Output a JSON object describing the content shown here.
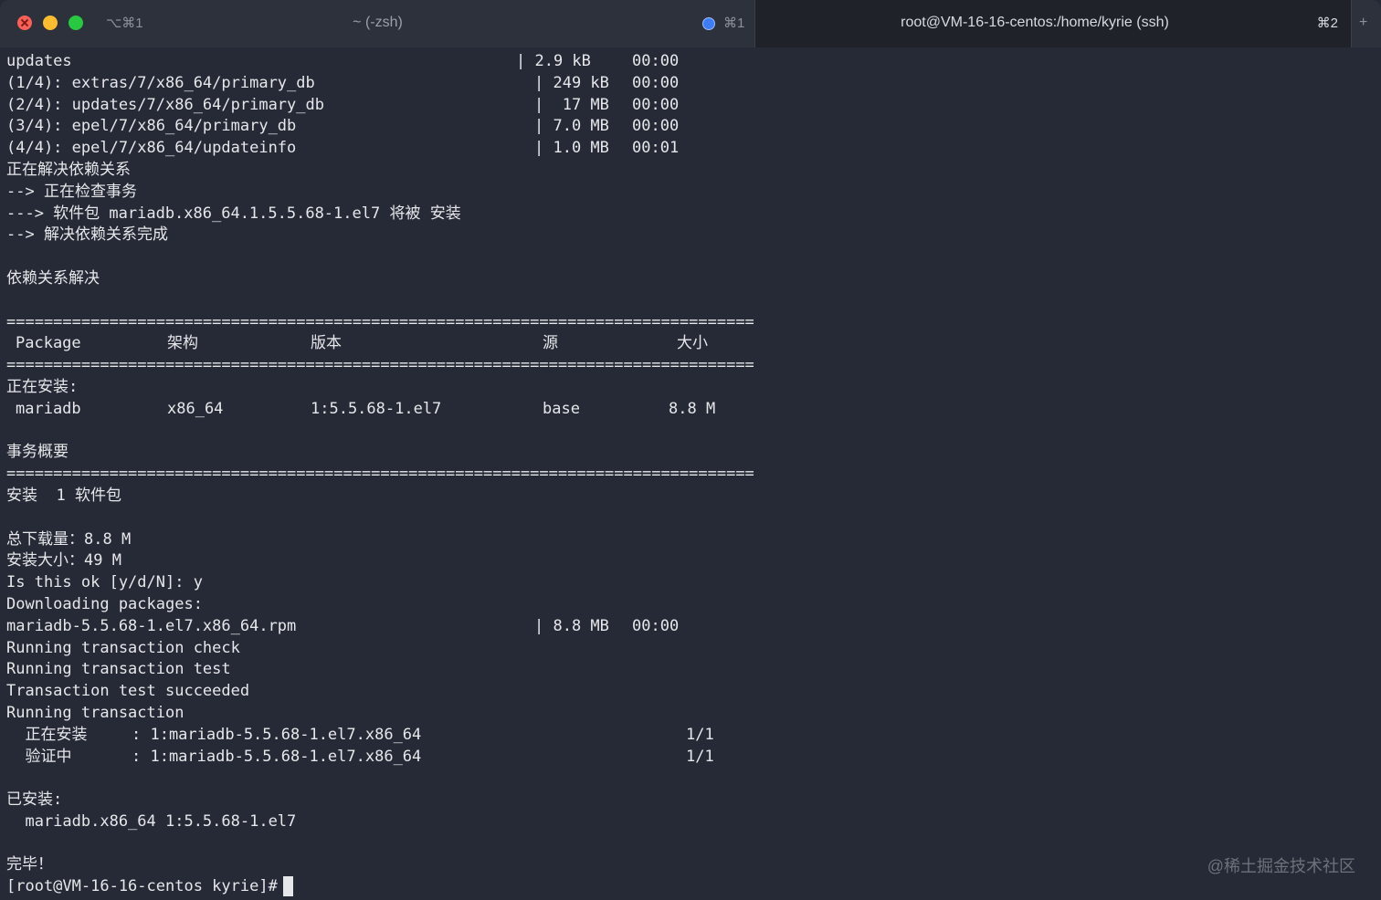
{
  "tab_bar": {
    "left_shortcut": "⌥⌘1",
    "tab1": {
      "title": "~ (-zsh)",
      "shortcut": "⌘1"
    },
    "tab2": {
      "title": "root@VM-16-16-centos:/home/kyrie (ssh)",
      "shortcut": "⌘2"
    },
    "new_tab": "+"
  },
  "terminal": {
    "download_rows": [
      {
        "name": "updates",
        "size": "| 2.9 kB",
        "time": "00:00"
      },
      {
        "name": "(1/4): extras/7/x86_64/primary_db",
        "size": "| 249 kB",
        "time": "00:00"
      },
      {
        "name": "(2/4): updates/7/x86_64/primary_db",
        "size": "|  17 MB",
        "time": "00:00"
      },
      {
        "name": "(3/4): epel/7/x86_64/primary_db",
        "size": "| 7.0 MB",
        "time": "00:00"
      },
      {
        "name": "(4/4): epel/7/x86_64/updateinfo",
        "size": "| 1.0 MB",
        "time": "00:01"
      }
    ],
    "resolving": "正在解决依赖关系",
    "checking": "--> 正在检查事务",
    "package_install": "---> 软件包 mariadb.x86_64.1.5.5.68-1.el7 将被 安装",
    "resolve_done": "--> 解决依赖关系完成",
    "deps_resolved": "依赖关系解决",
    "separator": "================================================================================",
    "table_header": {
      "package": "Package",
      "arch": "架构",
      "version": "版本",
      "repo": "源",
      "size": "大小"
    },
    "installing_label": "正在安装:",
    "table_row": {
      "package": "mariadb",
      "arch": "x86_64",
      "version": "1:5.5.68-1.el7",
      "repo": "base",
      "size": "8.8 M"
    },
    "summary_label": "事务概要",
    "install_count": "安装  1 软件包",
    "total_download": "总下载量：8.8 M",
    "install_size": "安装大小：49 M",
    "prompt_ok": "Is this ok [y/d/N]: y",
    "downloading": "Downloading packages:",
    "rpm_row": {
      "name": "mariadb-5.5.68-1.el7.x86_64.rpm",
      "size": "| 8.8 MB",
      "time": "00:00"
    },
    "check": "Running transaction check",
    "test": "Running transaction test",
    "test_ok": "Transaction test succeeded",
    "running": "Running transaction",
    "step_install": {
      "label": "  正在安装    ",
      "pkg": ": 1:mariadb-5.5.68-1.el7.x86_64",
      "count": "1/1"
    },
    "step_verify": {
      "label": "  验证中      ",
      "pkg": ": 1:mariadb-5.5.68-1.el7.x86_64",
      "count": "1/1"
    },
    "installed_label": "已安装:",
    "installed_pkg": "  mariadb.x86_64 1:5.5.68-1.el7",
    "complete": "完毕！",
    "shell_prompt": "[root@VM-16-16-centos kyrie]#"
  },
  "watermark": "@稀土掘金技术社区",
  "colors": {
    "background": "#262a36",
    "text": "#e6e7ea",
    "close": "#fe5f57",
    "minimize": "#febc2e",
    "maximize": "#28c840",
    "activity_dot": "#3d7cf5"
  }
}
